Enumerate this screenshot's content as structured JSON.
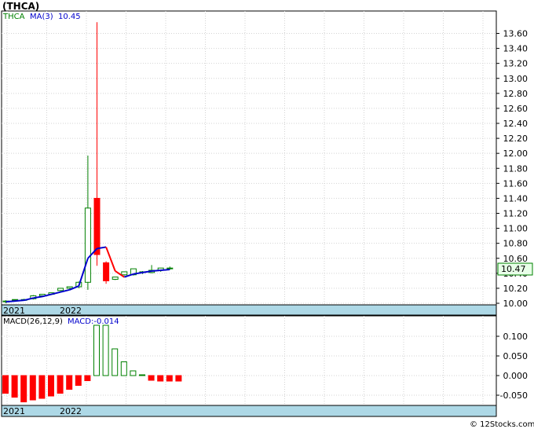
{
  "title": "(THCA)",
  "legend": {
    "symbol": "THCA",
    "ma_label": "MA(3)",
    "ma_value": "10.45",
    "macd_label": "MACD(26,12,9)",
    "macd_value": "MACD:-0.014"
  },
  "last_price": "10.47",
  "copyright": "© 12Stocks.com",
  "colors": {
    "up": "#008000",
    "down": "#ff0000",
    "ma_rising": "#0000cc",
    "ma_falling": "#ff0000",
    "grid": "#d3d3d3",
    "year_band": "#add8e6",
    "legend_symbol": "#008000",
    "legend_ma": "#0000cc"
  },
  "chart_data": [
    {
      "type": "candlestick",
      "name": "price",
      "x_labels": [
        "2021",
        "2022"
      ],
      "ylim": [
        10.0,
        13.7
      ],
      "y_ticks": [
        "10.00",
        "10.20",
        "10.40",
        "10.60",
        "10.80",
        "11.00",
        "11.20",
        "11.40",
        "11.60",
        "11.80",
        "12.00",
        "12.20",
        "12.40",
        "12.60",
        "12.80",
        "13.00",
        "13.20",
        "13.40",
        "13.60"
      ],
      "candles": [
        {
          "open": 10.02,
          "high": 10.04,
          "low": 10.0,
          "close": 10.03
        },
        {
          "open": 10.04,
          "high": 10.05,
          "low": 10.02,
          "close": 10.05
        },
        {
          "open": 10.05,
          "high": 10.06,
          "low": 10.04,
          "close": 10.05
        },
        {
          "open": 10.06,
          "high": 10.11,
          "low": 10.05,
          "close": 10.1
        },
        {
          "open": 10.1,
          "high": 10.12,
          "low": 10.09,
          "close": 10.12
        },
        {
          "open": 10.12,
          "high": 10.14,
          "low": 10.11,
          "close": 10.14
        },
        {
          "open": 10.17,
          "high": 10.2,
          "low": 10.16,
          "close": 10.2
        },
        {
          "open": 10.2,
          "high": 10.22,
          "low": 10.19,
          "close": 10.22
        },
        {
          "open": 10.22,
          "high": 10.29,
          "low": 10.2,
          "close": 10.28
        },
        {
          "open": 10.28,
          "high": 11.97,
          "low": 10.18,
          "close": 11.27
        },
        {
          "open": 11.4,
          "high": 13.75,
          "low": 10.5,
          "close": 10.65
        },
        {
          "open": 10.54,
          "high": 10.56,
          "low": 10.26,
          "close": 10.3
        },
        {
          "open": 10.32,
          "high": 10.35,
          "low": 10.31,
          "close": 10.35
        },
        {
          "open": 10.38,
          "high": 10.42,
          "low": 10.37,
          "close": 10.42
        },
        {
          "open": 10.38,
          "high": 10.46,
          "low": 10.37,
          "close": 10.46
        },
        {
          "open": 10.41,
          "high": 10.43,
          "low": 10.39,
          "close": 10.42
        },
        {
          "open": 10.41,
          "high": 10.51,
          "low": 10.4,
          "close": 10.44
        },
        {
          "open": 10.44,
          "high": 10.47,
          "low": 10.42,
          "close": 10.47
        },
        {
          "open": 10.46,
          "high": 10.49,
          "low": 10.45,
          "close": 10.47
        }
      ],
      "ma3": [
        10.02,
        10.03,
        10.04,
        10.07,
        10.09,
        10.12,
        10.15,
        10.18,
        10.23,
        10.6,
        10.73,
        10.75,
        10.43,
        10.35,
        10.39,
        10.41,
        10.43,
        10.44,
        10.45
      ]
    },
    {
      "type": "bar",
      "name": "MACD(26,12,9)",
      "ylim": [
        -0.068,
        0.14
      ],
      "y_ticks": [
        "0.100",
        "0.050",
        "0.000",
        "-0.050"
      ],
      "values": [
        -0.045,
        -0.055,
        -0.067,
        -0.062,
        -0.058,
        -0.052,
        -0.045,
        -0.035,
        -0.025,
        -0.013,
        0.128,
        0.128,
        0.068,
        0.035,
        0.012,
        0.002,
        -0.012,
        -0.014,
        -0.014,
        -0.014
      ]
    }
  ]
}
